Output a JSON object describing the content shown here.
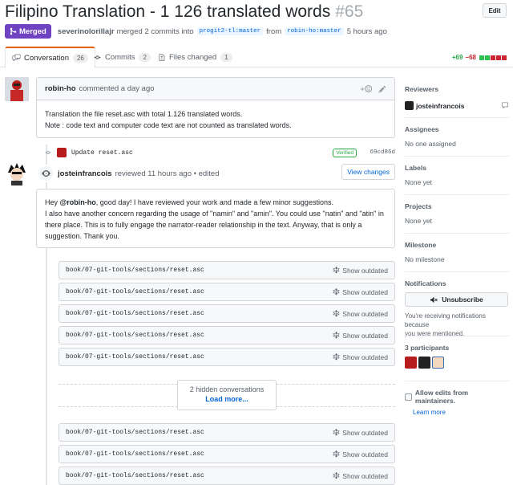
{
  "pr": {
    "title": "Filipino Translation - 1 126 translated words",
    "number": "#65",
    "edit_label": "Edit",
    "state": "Merged",
    "merger": "severinolorillajr",
    "merge_text": "merged 2 commits into",
    "base_branch": "progit2-tl:master",
    "from_text": "from",
    "head_branch": "robin-ho:master",
    "time": "5 hours ago"
  },
  "tabs": [
    {
      "label": "Conversation",
      "count": "26",
      "icon": "comment-discussion-icon"
    },
    {
      "label": "Commits",
      "count": "2",
      "icon": "git-commit-icon"
    },
    {
      "label": "Files changed",
      "count": "1",
      "icon": "file-diff-icon"
    }
  ],
  "diffstat": {
    "additions": "+69",
    "deletions": "−68"
  },
  "comment": {
    "author": "robin-ho",
    "action": "commented a day ago",
    "line1": "Translation the file reset.asc with total 1.126 translated words.",
    "line2": "Note : code text and computer code text are not counted as translated words."
  },
  "commit": {
    "message": "Update reset.asc",
    "badge": "Verified",
    "sha": "69cd86d"
  },
  "review": {
    "author": "josteinfrancois",
    "action": "reviewed 11 hours ago • edited",
    "view_changes": "View changes",
    "greeting": "Hey",
    "mention": "@robin-ho",
    "line1_rest": ", good day! I have reviewed your work and made a few minor suggestions.",
    "line2": "I also have another concern regarding the usage of \"namin\" and \"amin\". You could use \"natin\" and \"atin\" in",
    "line3": "there place. This is to fully engage the narrator-reader relationship in the text. Anyway, that is only a",
    "line4": "suggestion. Thank you."
  },
  "outdated": {
    "path": "book/07-git-tools/sections/reset.asc",
    "label": "Show outdated"
  },
  "hidden": {
    "text": "2 hidden conversations",
    "link": "Load more..."
  },
  "sidebar": {
    "reviewers_h": "Reviewers",
    "reviewer": "josteinfrancois",
    "assignees_h": "Assignees",
    "assignees_v": "No one assigned",
    "labels_h": "Labels",
    "labels_v": "None yet",
    "projects_h": "Projects",
    "projects_v": "None yet",
    "milestone_h": "Milestone",
    "milestone_v": "No milestone",
    "notifications_h": "Notifications",
    "unsubscribe": "Unsubscribe",
    "notif_line1": "You're receiving notifications because",
    "notif_line2": "you were mentioned.",
    "participants_h": "3 participants",
    "allow_edits": "Allow edits from maintainers.",
    "learn_more": "Learn more"
  },
  "colors": {
    "merged": "#6f42c1",
    "link": "#0366d6",
    "add": "#28a745",
    "del": "#cb2431"
  }
}
